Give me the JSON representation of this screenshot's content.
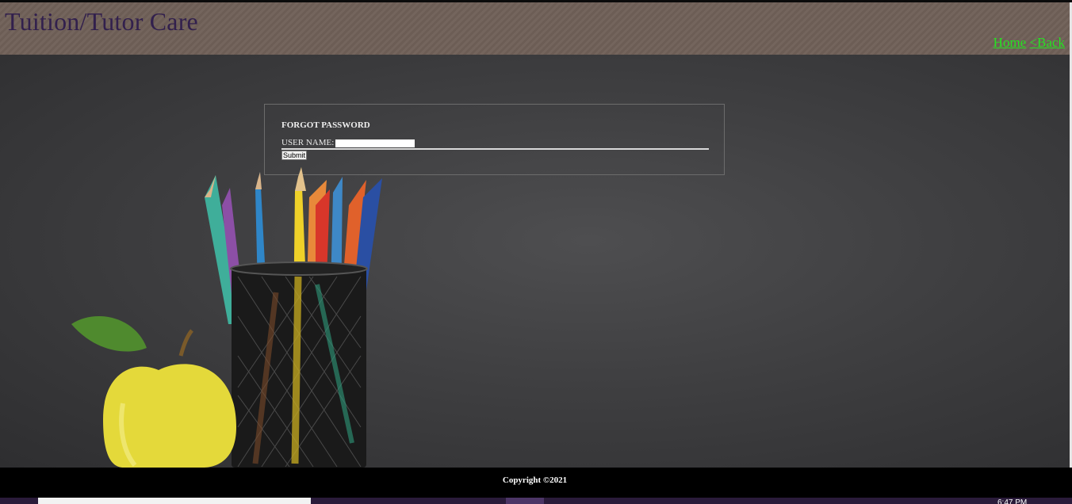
{
  "header": {
    "title": "Tuition/Tutor Care",
    "nav": {
      "home": "Home",
      "back": "<Back"
    }
  },
  "form": {
    "title": "FORGOT PASSWORD",
    "username_label": "USER NAME:",
    "username_value": "",
    "submit_label": "Submit"
  },
  "footer": {
    "copyright": "Copyright ©2021"
  },
  "colors": {
    "header_bg": "#6f6058",
    "title_color": "#32204d",
    "nav_link": "#25e321",
    "main_bg": "#3f3f41",
    "footer_bg": "#000000"
  },
  "taskbar": {
    "clock": "6:47 PM"
  },
  "icons": [
    "apple-icon",
    "pencil-cup-icon"
  ]
}
